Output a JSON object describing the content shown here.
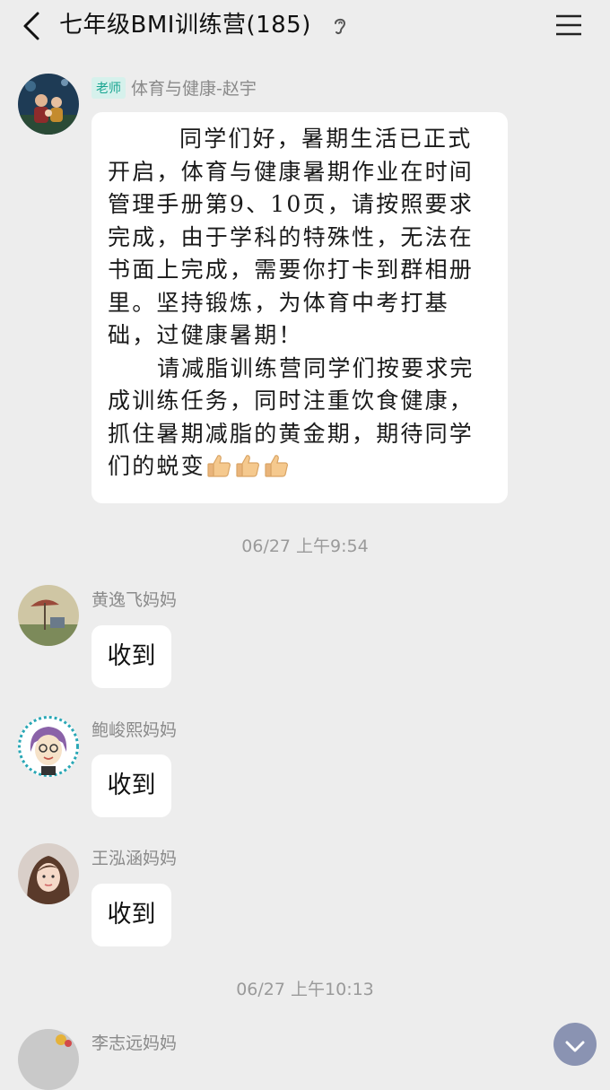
{
  "header": {
    "title": "七年级BMI训练营(185)"
  },
  "messages": [
    {
      "tag": "老师",
      "sender": "体育与健康-赵宇",
      "paragraphs": [
        "同学们好，暑期生活已正式开启，体育与健康暑期作业在时间管理手册第9、10页，请按照要求完成，由于学科的特殊性，无法在书面上完成，需要你打卡到群相册里。坚持锻炼，为体育中考打基础，过健康暑期！",
        "请减脂训练营同学们按要求完成训练任务，同时注重饮食健康，抓住暑期减脂的黄金期，期待同学们的蜕变"
      ],
      "emoji": "thumbs-up-icon ×3"
    },
    {
      "sender": "黄逸飞妈妈",
      "text": "收到"
    },
    {
      "sender": "鲍峻熙妈妈",
      "text": "收到"
    },
    {
      "sender": "王泓涵妈妈",
      "text": "收到"
    },
    {
      "sender": "李志远妈妈"
    }
  ],
  "timestamps": [
    "06/27 上午9:54",
    "06/27 上午10:13"
  ],
  "colors": {
    "background": "#ededed",
    "bubble": "#ffffff",
    "teacher_tag_bg": "#d6f1ec",
    "teacher_tag_text": "#19a591",
    "scroll_button": "#8a93b2"
  }
}
